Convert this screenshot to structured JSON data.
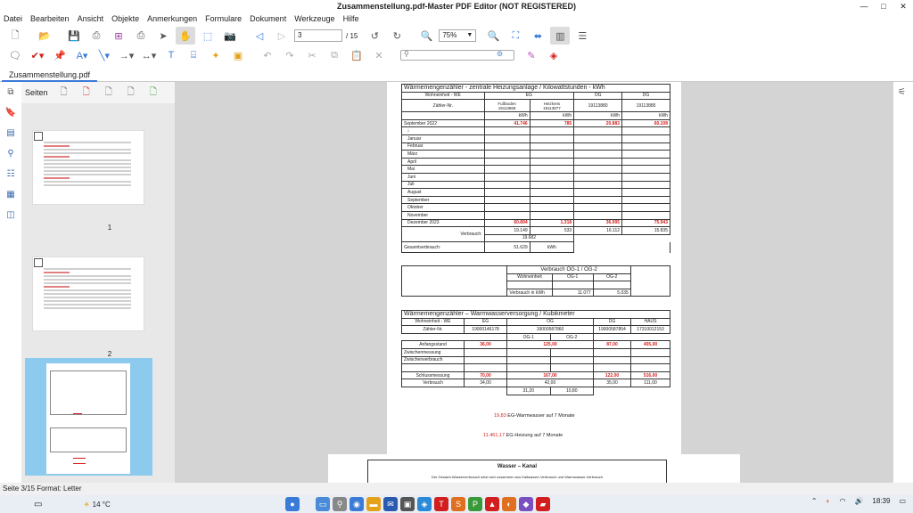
{
  "window": {
    "title": "Zusammenstellung.pdf-Master PDF Editor (NOT REGISTERED)",
    "minimize": "—",
    "maximize": "□",
    "close": "✕"
  },
  "menu": [
    "Datei",
    "Bearbeiten",
    "Ansicht",
    "Objekte",
    "Anmerkungen",
    "Formulare",
    "Dokument",
    "Werkzeuge",
    "Hilfe"
  ],
  "toolbar": {
    "page_value": "3",
    "page_total": "/ 15",
    "zoom": "75%"
  },
  "tab": {
    "label": "Zusammenstellung.pdf"
  },
  "sidebar": {
    "label": "Seiten",
    "thumbs": [
      {
        "num": "1"
      },
      {
        "num": "2"
      }
    ]
  },
  "heat": {
    "title": "Wärmemengenzähler - zentrale Heizungsanlage   /   Kilowattstunden - kWh",
    "row_we": [
      "Wohneinheit - WE",
      "EG",
      "OG",
      "DG"
    ],
    "zaehler_label": "Zähler-Nr.",
    "zaehler": [
      "Fußboden\n19113868",
      "Heizkreis\n19113877",
      "19113880",
      "19113885"
    ],
    "unit": "kWh",
    "sep_label": "September 2022",
    "sep_values": [
      "41.746",
      "785",
      "20.883",
      "60.108"
    ],
    "months": [
      "Januar",
      "Februar",
      "März",
      "April",
      "Mai",
      "Juni",
      "Juli",
      "August",
      "September",
      "Oktober",
      "November"
    ],
    "dez_label": "Dezember 2023",
    "dez_values": [
      "60.894",
      "1.318",
      "36.995",
      "75.943"
    ],
    "verbrauch_label": "Verbrauch:",
    "verbrauch_values": [
      "19.149",
      "533",
      "16.112",
      "15.835"
    ],
    "verbrauch_eg_sum": "19.682",
    "gesamt_label": "Gesamtverbrauch:",
    "gesamt_value": "51.629",
    "gesamt_unit": "kWh",
    "og_split_title": "Verbrauch OG-1 / OG-2",
    "og_split_hdr": [
      "Wohneinheit",
      "OG-1",
      "OG-2"
    ],
    "og_split_label": "Verbrauch in kWh",
    "og_split_values": [
      "11.077",
      "5.035"
    ]
  },
  "water": {
    "title": "Wärmemengenzähler – Warmwasserversorgung   /   Kubikmeter",
    "hdr": [
      "Wohneinheit - WE",
      "EG",
      "OG",
      "DG",
      "HAUS"
    ],
    "zaehler_label": "Zähler-Nr.",
    "zaehler": [
      "19000146178",
      "19000587860",
      "19000587854",
      "17310012153"
    ],
    "og_sub": [
      "OG-1",
      "OG-2"
    ],
    "rows": [
      "Anfangsstand",
      "Zwischenmessung",
      "Zwischenverbrauch"
    ],
    "anfang": [
      "36,00",
      "125,00",
      "87,00",
      "405,00"
    ],
    "schluss_label": "Schlussmessung",
    "schluss": [
      "70,00",
      "167,00",
      "122,00",
      "516,00"
    ],
    "verbrauch_label": "Verbrauch",
    "verbrauch": [
      "34,00",
      "42,00",
      "35,00",
      "111,00"
    ],
    "og_split": [
      "31,20",
      "10,80"
    ]
  },
  "notes": [
    {
      "value": "19,83",
      "text": "EG-Warmwasser auf 7 Monate"
    },
    {
      "value": "11.461,17",
      "text": "EG-Heizung auf 7 Monate"
    }
  ],
  "page2": {
    "title": "Wasser – Kanal",
    "text": "Der Gesamt-Wasserverbrauch setzt sich zusammen aus Kaltwasser-Verbrauch und Warmwasser-Verbrauch"
  },
  "status": "Seite 3/15 Format: Letter",
  "taskbar": {
    "temperature": "14 °C",
    "time": "18:39"
  }
}
